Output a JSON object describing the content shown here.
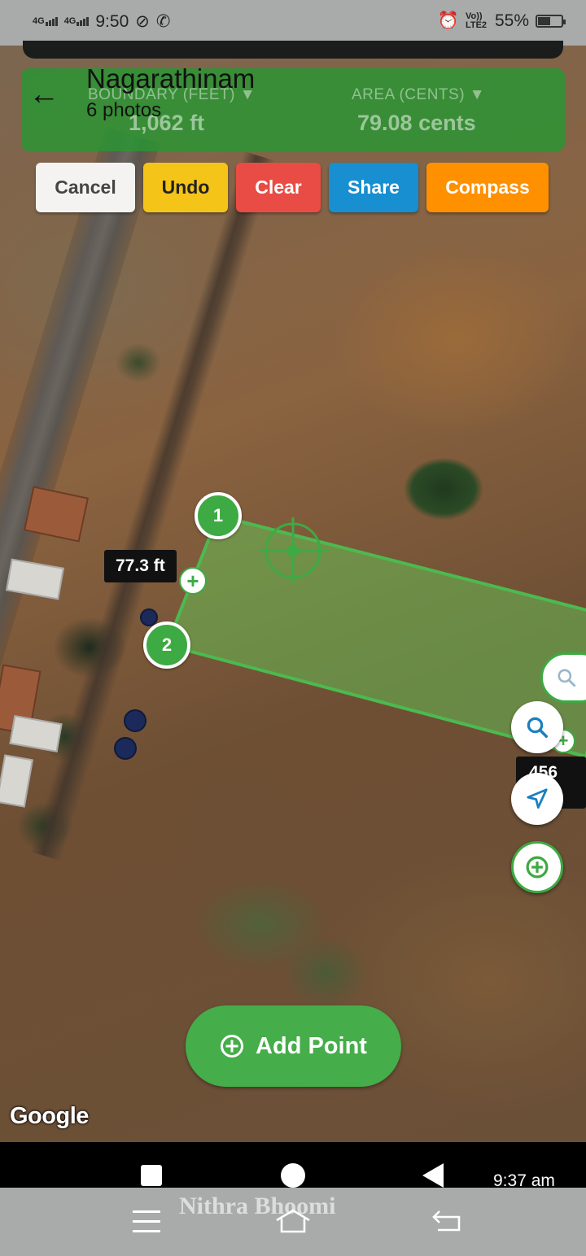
{
  "status_bar": {
    "network_1": "4G",
    "network_2": "4G",
    "time": "9:50",
    "volte": "Vo)) LTE2",
    "battery_percent": "55%",
    "battery_level": 0.55
  },
  "header": {
    "title": "Nagarathinam",
    "subtitle": "6 photos",
    "boundary_label": "BOUNDARY (FEET) ▼",
    "boundary_value": "1,062 ft",
    "area_label": "AREA (CENTS) ▼",
    "area_value": "79.08 cents"
  },
  "toolbar": {
    "cancel": "Cancel",
    "undo": "Undo",
    "clear": "Clear",
    "share": "Share",
    "compass": "Compass"
  },
  "map": {
    "vertices": [
      "1",
      "2"
    ],
    "segment_lengths": [
      "77.3 ft",
      "456 ft"
    ],
    "attribution": "Google",
    "accent_color": "#3daa43"
  },
  "actions": {
    "add_point": "Add Point"
  },
  "system_nav": {
    "time": "9:37 am",
    "watermark": "Nithra Bhoomi"
  }
}
